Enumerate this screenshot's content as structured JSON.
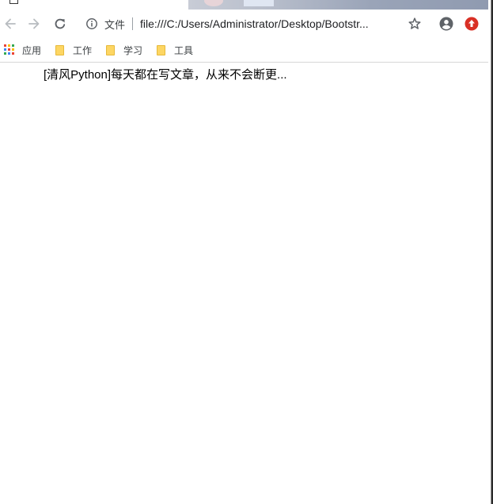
{
  "toolbar": {
    "back_icon": "arrow-left-icon",
    "forward_icon": "arrow-right-icon",
    "reload_icon": "reload-icon",
    "info_icon": "info-icon",
    "scheme_label": "文件",
    "url": "file:///C:/Users/Administrator/Desktop/Bootstr...",
    "bookmark_star_icon": "star-icon",
    "profile_icon": "account-circle-icon",
    "extension_icon": "red-upload-icon"
  },
  "bookmarks": {
    "apps_label": "应用",
    "items": [
      {
        "label": "工作"
      },
      {
        "label": "学习"
      },
      {
        "label": "工具"
      }
    ]
  },
  "page": {
    "headline": "[清风Python]每天都在写文章，从来不会断更..."
  },
  "colors": {
    "extension_red": "#d93025",
    "folder_yellow": "#fdd663",
    "icon_gray": "#5f6368"
  }
}
